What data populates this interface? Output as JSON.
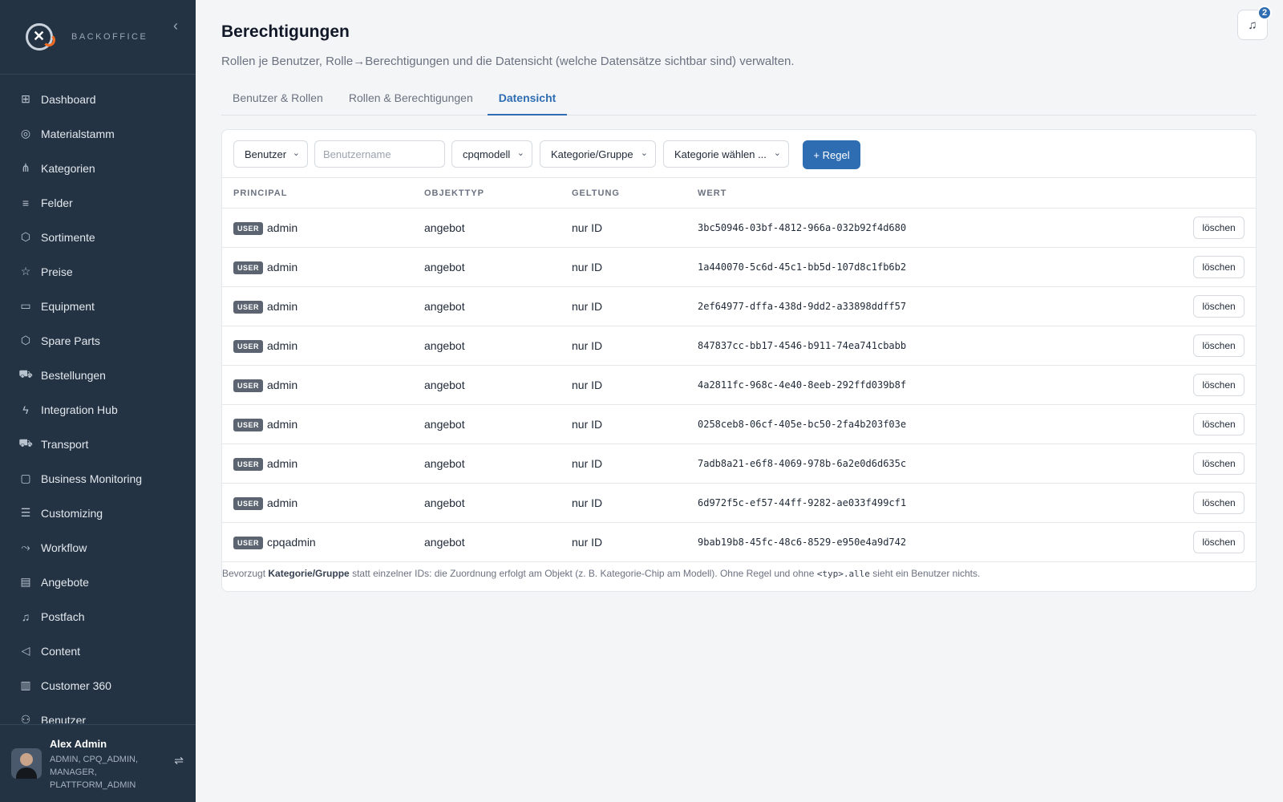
{
  "brand": {
    "text": "BACKOFFICE",
    "collapse_glyph": "‹"
  },
  "sidebar": {
    "items": [
      {
        "label": "Dashboard",
        "icon": "⊞",
        "icon_name": "dashboard-icon"
      },
      {
        "label": "Materialstamm",
        "icon": "◎",
        "icon_name": "database-icon"
      },
      {
        "label": "Kategorien",
        "icon": "⋔",
        "icon_name": "hierarchy-icon"
      },
      {
        "label": "Felder",
        "icon": "≡",
        "icon_name": "list-icon"
      },
      {
        "label": "Sortimente",
        "icon": "⬡",
        "icon_name": "box-icon"
      },
      {
        "label": "Preise",
        "icon": "☆",
        "icon_name": "star-icon"
      },
      {
        "label": "Equipment",
        "icon": "▭",
        "icon_name": "monitor-icon"
      },
      {
        "label": "Spare Parts",
        "icon": "⬡",
        "icon_name": "package-icon"
      },
      {
        "label": "Bestellungen",
        "icon": "⛟",
        "icon_name": "cart-icon"
      },
      {
        "label": "Integration Hub",
        "icon": "ϟ",
        "icon_name": "lightning-icon"
      },
      {
        "label": "Transport",
        "icon": "⛟",
        "icon_name": "truck-icon"
      },
      {
        "label": "Business Monitoring",
        "icon": "▢",
        "icon_name": "chat-icon"
      },
      {
        "label": "Customizing",
        "icon": "☰",
        "icon_name": "sliders-icon"
      },
      {
        "label": "Workflow",
        "icon": "⤳",
        "icon_name": "workflow-icon"
      },
      {
        "label": "Angebote",
        "icon": "▤",
        "icon_name": "document-icon"
      },
      {
        "label": "Postfach",
        "icon": "♫",
        "icon_name": "bell-icon"
      },
      {
        "label": "Content",
        "icon": "◁",
        "icon_name": "megaphone-icon"
      },
      {
        "label": "Customer 360",
        "icon": "▥",
        "icon_name": "building-icon"
      },
      {
        "label": "Benutzer",
        "icon": "⚇",
        "icon_name": "users-icon"
      }
    ]
  },
  "user": {
    "name": "Alex Admin",
    "roles": "ADMIN, CPQ_ADMIN, MANAGER, PLATTFORM_ADMIN",
    "settings_glyph": "⇌"
  },
  "header": {
    "title": "Berechtigungen",
    "subtitle": "Rollen je Benutzer, Rolle→Berechtigungen und die Datensicht (welche Datensätze sichtbar sind) verwalten.",
    "notification_count": "2",
    "bell_glyph": "♫"
  },
  "tabs": [
    {
      "label": "Benutzer & Rollen",
      "active": false
    },
    {
      "label": "Rollen & Berechtigungen",
      "active": false
    },
    {
      "label": "Datensicht",
      "active": true
    }
  ],
  "toolbar": {
    "principal_type": "Benutzer",
    "username_placeholder": "Benutzername",
    "object_type": "cpqmodell",
    "scope": "Kategorie/Gruppe",
    "category": "Kategorie wählen ...",
    "add_label": "+ Regel",
    "chevron": "⌄"
  },
  "table": {
    "headers": [
      "PRINCIPAL",
      "OBJEKTTYP",
      "GELTUNG",
      "WERT"
    ],
    "delete_label": "löschen",
    "rows": [
      {
        "badge": "USER",
        "principal": "admin",
        "objekttyp": "angebot",
        "geltung": "nur ID",
        "wert": "3bc50946-03bf-4812-966a-032b92f4d680"
      },
      {
        "badge": "USER",
        "principal": "admin",
        "objekttyp": "angebot",
        "geltung": "nur ID",
        "wert": "1a440070-5c6d-45c1-bb5d-107d8c1fb6b2"
      },
      {
        "badge": "USER",
        "principal": "admin",
        "objekttyp": "angebot",
        "geltung": "nur ID",
        "wert": "2ef64977-dffa-438d-9dd2-a33898ddff57"
      },
      {
        "badge": "USER",
        "principal": "admin",
        "objekttyp": "angebot",
        "geltung": "nur ID",
        "wert": "847837cc-bb17-4546-b911-74ea741cbabb"
      },
      {
        "badge": "USER",
        "principal": "admin",
        "objekttyp": "angebot",
        "geltung": "nur ID",
        "wert": "4a2811fc-968c-4e40-8eeb-292ffd039b8f"
      },
      {
        "badge": "USER",
        "principal": "admin",
        "objekttyp": "angebot",
        "geltung": "nur ID",
        "wert": "0258ceb8-06cf-405e-bc50-2fa4b203f03e"
      },
      {
        "badge": "USER",
        "principal": "admin",
        "objekttyp": "angebot",
        "geltung": "nur ID",
        "wert": "7adb8a21-e6f8-4069-978b-6a2e0d6d635c"
      },
      {
        "badge": "USER",
        "principal": "admin",
        "objekttyp": "angebot",
        "geltung": "nur ID",
        "wert": "6d972f5c-ef57-44ff-9282-ae033f499cf1"
      },
      {
        "badge": "USER",
        "principal": "cpqadmin",
        "objekttyp": "angebot",
        "geltung": "nur ID",
        "wert": "9bab19b8-45fc-48c6-8529-e950e4a9d742"
      }
    ]
  },
  "hint": {
    "pre": "Bevorzugt ",
    "bold": "Kategorie/Gruppe",
    "mid": " statt einzelner IDs: die Zuordnung erfolgt am Objekt (z. B. Kategorie-Chip am Modell). Ohne Regel und ohne ",
    "code": "<typ>.alle",
    "post": " sieht ein Benutzer nichts."
  },
  "colors": {
    "sidebar_bg": "#243343",
    "accent": "#2f6db3",
    "badge_bg": "#5b6470"
  }
}
